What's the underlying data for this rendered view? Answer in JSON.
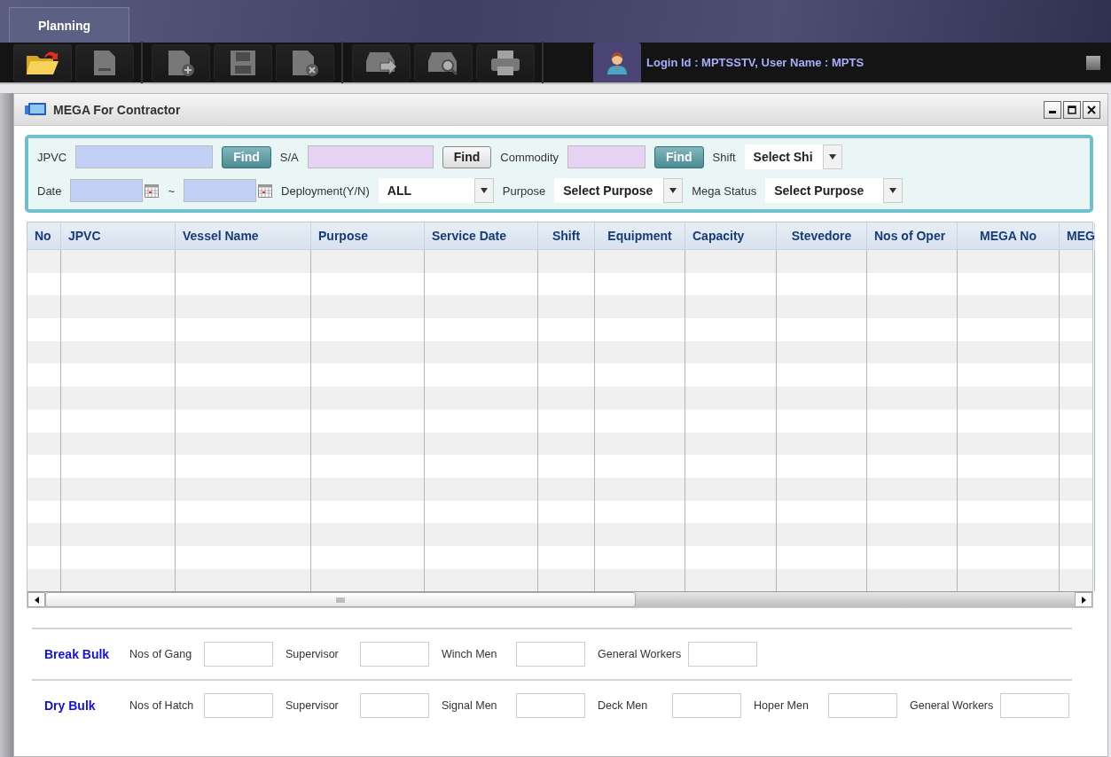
{
  "tabs": [
    {
      "label": "Planning",
      "selected": true
    }
  ],
  "toolbar": {
    "groups": [
      [
        {
          "kind": "open",
          "disabled": false
        },
        {
          "kind": "new",
          "disabled": true
        }
      ],
      [
        {
          "kind": "add",
          "disabled": true
        },
        {
          "kind": "save",
          "disabled": true
        },
        {
          "kind": "delete",
          "disabled": true
        }
      ],
      [
        {
          "kind": "export",
          "disabled": true
        },
        {
          "kind": "search",
          "disabled": true
        },
        {
          "kind": "print",
          "disabled": true
        }
      ]
    ],
    "user": "Login Id : MPTSSTV, User Name : MPTS"
  },
  "window": {
    "title": "MEGA For Contractor"
  },
  "filters": [
    [
      {
        "kind": "label",
        "text": "JPVC"
      },
      {
        "kind": "input",
        "color": "#c3d0f5"
      },
      {
        "kind": "button",
        "text": "Find",
        "primary": true
      },
      {
        "kind": "label",
        "text": "S/A"
      },
      {
        "kind": "input",
        "color": "#e6d3f3"
      },
      {
        "kind": "button",
        "text": "Find",
        "primary": false
      },
      {
        "kind": "label",
        "text": "Commodity"
      },
      {
        "kind": "input",
        "color": "#e6d3f3"
      },
      {
        "kind": "button",
        "text": "Find",
        "primary": true
      },
      {
        "kind": "label",
        "text": "Shift"
      },
      {
        "kind": "select",
        "value": "Select Shi"
      }
    ],
    [
      {
        "kind": "label",
        "text": "Date"
      },
      {
        "kind": "date",
        "color": "#c3d0f5"
      },
      {
        "kind": "label",
        "text": "~"
      },
      {
        "kind": "date",
        "color": "#c3d0f5"
      },
      {
        "kind": "label",
        "text": "Deployment(Y/N)"
      },
      {
        "kind": "select",
        "value": "ALL"
      },
      {
        "kind": "label",
        "text": "Purpose"
      },
      {
        "kind": "select",
        "value": "Select Purpose"
      },
      {
        "kind": "label",
        "text": "Mega Status"
      },
      {
        "kind": "select",
        "value": "Select Purpose"
      }
    ]
  ],
  "table": {
    "columns": [
      "No",
      "JPVC",
      "Vessel Name",
      "Purpose",
      "Service Date",
      "Shift",
      "Equipment",
      "Capacity",
      "Stevedore",
      "Nos of Oper",
      "MEGA No",
      "MEG"
    ]
  },
  "groups": [
    {
      "title": "Break Bulk",
      "fields": [
        "Nos of Gang",
        "Supervisor",
        "Winch Men",
        "General Workers"
      ]
    },
    {
      "title": "Dry Bulk",
      "fields": [
        "Nos of Hatch",
        "Supervisor",
        "Signal Men",
        "Deck Men",
        "Hoper Men",
        "General Workers"
      ]
    }
  ]
}
